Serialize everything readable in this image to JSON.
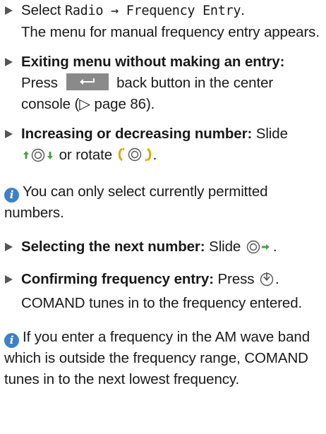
{
  "steps": [
    {
      "a": "Select ",
      "menu1": "Radio",
      "arrow": " → ",
      "menu2": "Frequency Entry",
      "b": ".",
      "line2": "The menu for manual frequency entry appears."
    },
    {
      "bold": "Exiting menu without making an entry:",
      "a": " Press ",
      "b": " back button in the center console (",
      "ref_symbol": "▷",
      "c": " page 86)."
    },
    {
      "bold": "Increasing or decreasing number:",
      "a": " Slide ",
      "b": " or rotate ",
      "c": "."
    },
    {
      "bold": "Selecting the next number:",
      "a": " Slide ",
      "b": "."
    },
    {
      "bold": "Confirming frequency entry:",
      "a": " Press ",
      "b": ".",
      "line2": "COMAND tunes in to the frequency entered."
    }
  ],
  "notes": [
    {
      "icon": "i",
      "text": "You can only select currently permitted numbers."
    },
    {
      "icon": "i",
      "text": "If you enter a frequency in the AM wave band which is outside the frequency range, COMAND tunes in to the next lowest frequency."
    }
  ],
  "colors": {
    "info_icon": "#3d82c4",
    "rotate_brackets": "#e0a800",
    "slide_arrows": "#4aa04a",
    "back_button": "#8a8a8a"
  }
}
